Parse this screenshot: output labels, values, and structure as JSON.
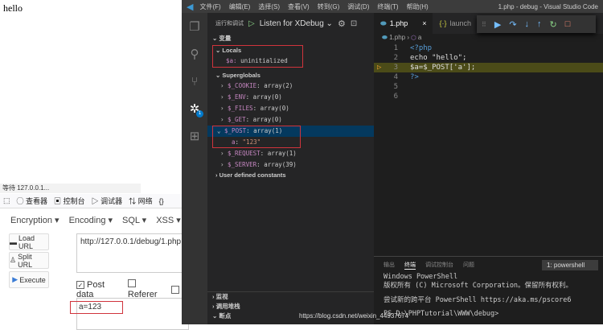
{
  "browser": {
    "body_text": "hello",
    "status": "等待 127.0.0.1...",
    "devtools_tabs": [
      "查看器",
      "控制台",
      "调试器",
      "网络",
      "{}"
    ],
    "hackbar_menus": [
      "Encryption ▾",
      "Encoding ▾",
      "SQL ▾",
      "XSS ▾"
    ],
    "buttons": {
      "load": "Load URL",
      "split": "Split URL",
      "execute": "Execute"
    },
    "url": "http://127.0.0.1/debug/1.php",
    "checks": {
      "post": "Post data",
      "referer": "Referer"
    },
    "post_data": "a=123"
  },
  "vscode": {
    "menu": [
      "文件(F)",
      "编辑(E)",
      "选择(S)",
      "查看(V)",
      "转到(G)",
      "调试(D)",
      "终端(T)",
      "帮助(H)"
    ],
    "title": "1.php - debug - Visual Studio Code",
    "run_label": "运行和调试",
    "config": "Listen for XDebug",
    "badge": "1",
    "variables_header": "变量",
    "locals": "Locals",
    "local_var": {
      "name": "$a",
      "value": "uninitialized"
    },
    "superglobals": "Superglobals",
    "globals": [
      {
        "name": "$_COOKIE",
        "value": "array(2)"
      },
      {
        "name": "$_ENV",
        "value": "array(0)"
      },
      {
        "name": "$_FILES",
        "value": "array(0)"
      },
      {
        "name": "$_GET",
        "value": "array(0)"
      },
      {
        "name": "$_POST",
        "value": "array(1)"
      },
      {
        "name": "$_REQUEST",
        "value": "array(1)"
      },
      {
        "name": "$_SERVER",
        "value": "array(39)"
      }
    ],
    "post_child": {
      "name": "a",
      "value": "\"123\""
    },
    "user_constants": "User defined constants",
    "sections": [
      "监视",
      "调用堆栈",
      "断点"
    ],
    "tabs": [
      "1.php",
      "launch"
    ],
    "breadcrumb": [
      "1.php",
      "a"
    ],
    "code": [
      "<?php",
      "echo \"hello\";",
      "$a=$_POST['a'];",
      "?>",
      "",
      ""
    ],
    "panel_tabs": [
      "输出",
      "终端",
      "调试控制台",
      "问题"
    ],
    "terminal_select": "1: powershell",
    "terminal": [
      "Windows PowerShell",
      "版权所有 (C) Microsoft Corporation。保留所有权利。",
      "",
      "尝试新的跨平台 PowerShell https://aka.ms/pscore6",
      "",
      "PS D:\\PHPTutorial\\WWW\\debug> "
    ],
    "watermark": "https://blog.csdn.net/weixin_44937674"
  }
}
